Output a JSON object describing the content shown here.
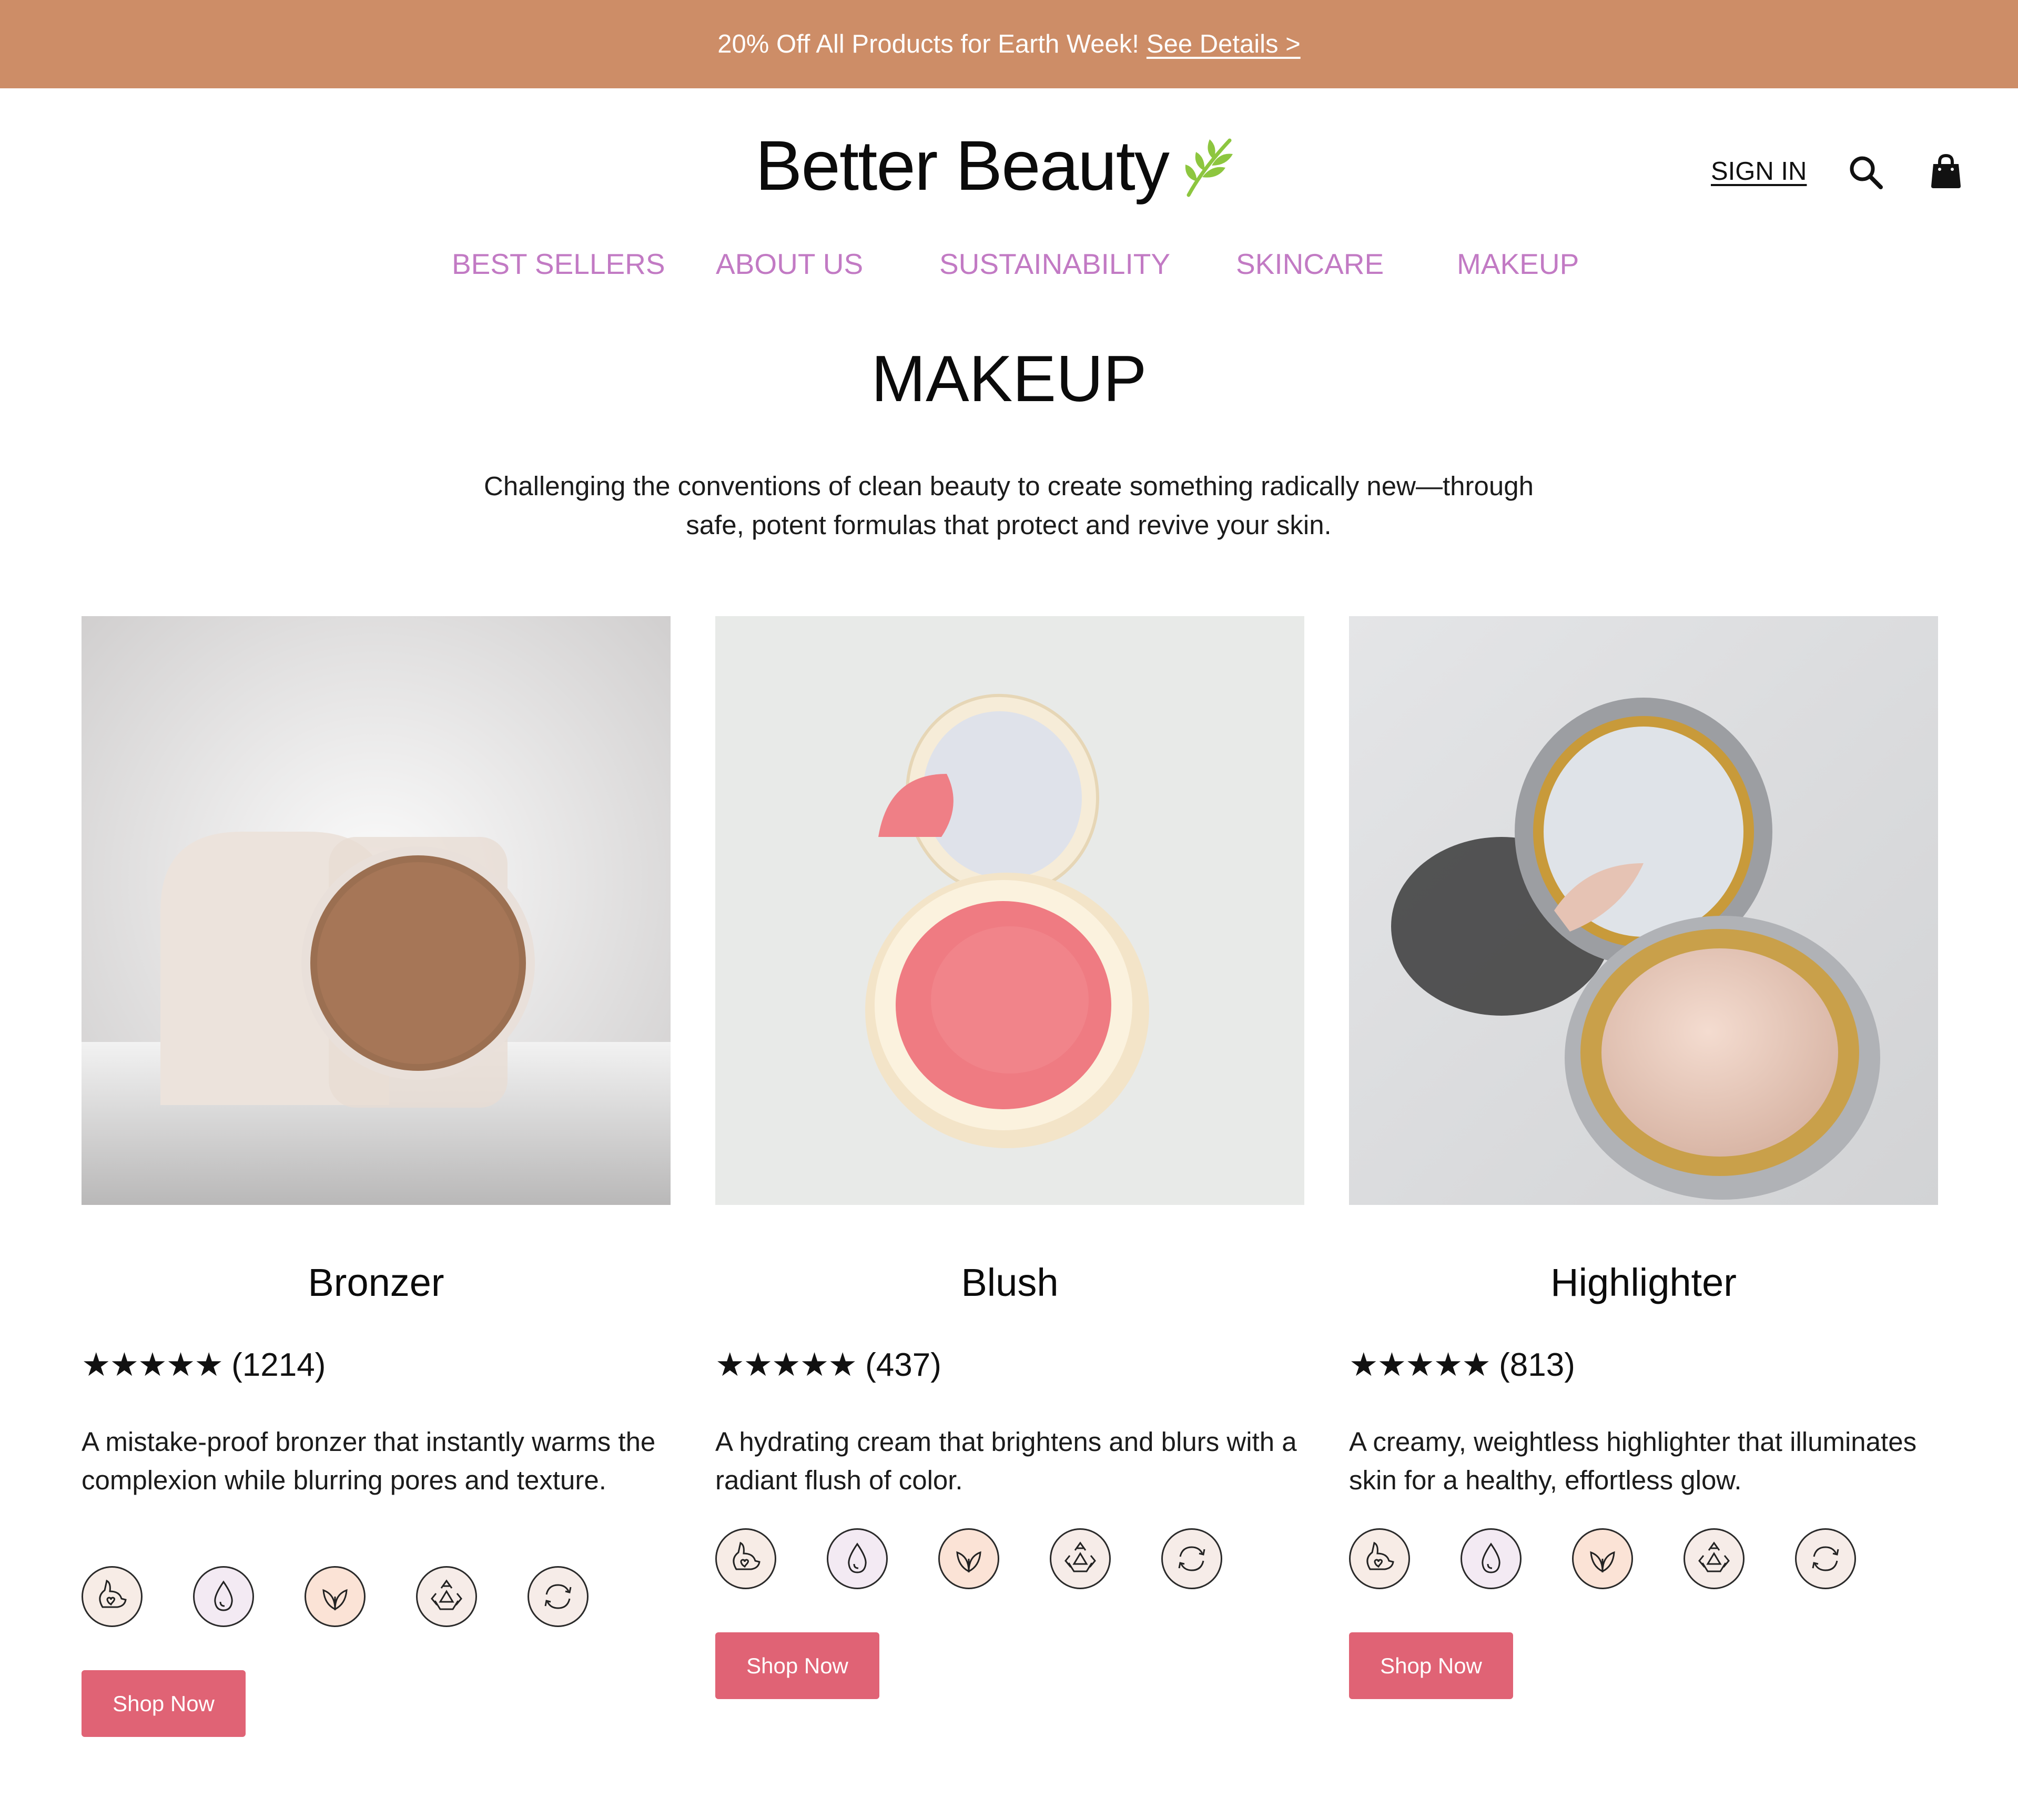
{
  "promo": {
    "text": "20% Off All Products for Earth Week!",
    "link_label": "See Details >"
  },
  "header": {
    "brand": "Better Beauty",
    "signin_label": "SIGN IN",
    "search_icon": "search-icon",
    "bag_icon": "shopping-bag-icon",
    "logo_icon": "leaf-sprig-icon"
  },
  "nav": {
    "items": [
      "BEST SELLERS",
      "ABOUT US",
      "SUSTAINABILITY",
      "SKINCARE",
      "MAKEUP"
    ]
  },
  "page": {
    "title": "MAKEUP",
    "intro": "Challenging the conventions of clean beauty to create something radically new—through safe, potent formulas that protect and revive your skin."
  },
  "products": [
    {
      "name": "Bronzer",
      "stars": "★★★★★",
      "reviews": "(1214)",
      "description": "A mistake-proof bronzer that instantly warms the complexion while blurring pores and texture.",
      "cta": "Shop Now"
    },
    {
      "name": "Blush",
      "stars": "★★★★★",
      "reviews": "(437)",
      "description": "A hydrating cream that brightens and blurs with a radiant flush of color.",
      "cta": "Shop Now"
    },
    {
      "name": "Highlighter",
      "stars": "★★★★★",
      "reviews": "(813)",
      "description": "A creamy, weightless highlighter that illuminates skin for a healthy, effortless glow.",
      "cta": "Shop Now"
    }
  ],
  "badges": [
    {
      "icon": "cruelty-free-bunny-icon",
      "bg": "#f7ece6"
    },
    {
      "icon": "water-drop-icon",
      "bg": "#f3eaf3"
    },
    {
      "icon": "vegan-leaf-icon",
      "bg": "#fbe3d6"
    },
    {
      "icon": "recycle-icon",
      "bg": "#f6ece8"
    },
    {
      "icon": "refillable-icon",
      "bg": "#f6ece8"
    }
  ],
  "colors": {
    "promo_bg": "#cd8d67",
    "nav_text": "#c27ac4",
    "cta_bg": "#e06375"
  }
}
